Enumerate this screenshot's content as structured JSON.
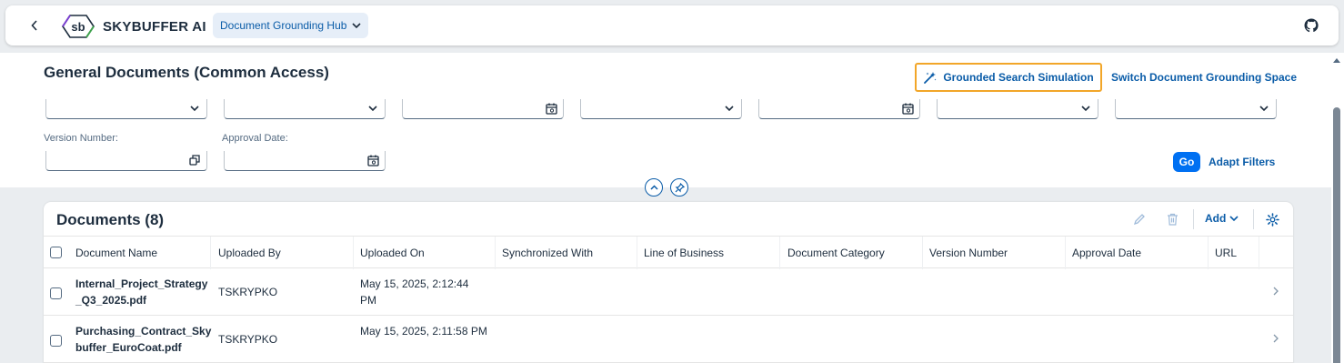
{
  "shell": {
    "brand": "SKYBUFFER AI",
    "logo_text": "sb",
    "hub_label": "Document Grounding Hub"
  },
  "header": {
    "title": "General Documents (Common Access)",
    "grounded_search_label": "Grounded Search Simulation",
    "switch_space_label": "Switch Document Grounding Space",
    "version_number_label": "Version Number:",
    "approval_date_label": "Approval Date:",
    "go_label": "Go",
    "adapt_filters_label": "Adapt Filters"
  },
  "table": {
    "title": "Documents (8)",
    "add_label": "Add",
    "columns": [
      "Document Name",
      "Uploaded By",
      "Uploaded On",
      "Synchronized With",
      "Line of Business",
      "Document Category",
      "Version Number",
      "Approval Date",
      "URL"
    ],
    "rows": [
      {
        "name": "Internal_Project_Strategy_Q3_2025.pdf",
        "uploaded_by": "TSKRYPKO",
        "uploaded_on": "May 15, 2025, 2:12:44 PM"
      },
      {
        "name": "Purchasing_Contract_Skybuffer_EuroCoat.pdf",
        "uploaded_by": "TSKRYPKO",
        "uploaded_on": "May 15, 2025, 2:11:58 PM"
      }
    ]
  },
  "colors": {
    "accent": "#0a5ca8",
    "highlight": "#f2a629",
    "go": "#0070f2"
  }
}
